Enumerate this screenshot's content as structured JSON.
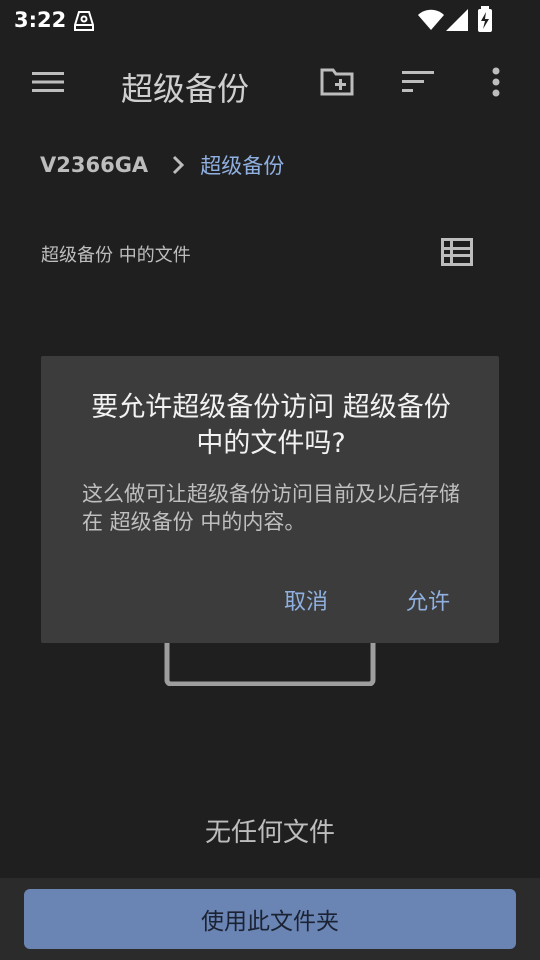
{
  "status_bar": {
    "time": "3:22"
  },
  "app_bar": {
    "title": "超级备份"
  },
  "breadcrumb": {
    "root": "V2366GA",
    "current": "超级备份"
  },
  "section": {
    "label": "超级备份 中的文件"
  },
  "empty_state": {
    "text": "无任何文件"
  },
  "bottom": {
    "use_folder_label": "使用此文件夹"
  },
  "dialog": {
    "title": "要允许超级备份访问 超级备份 中的文件吗?",
    "message": "这么做可让超级备份访问目前及以后存储在 超级备份 中的内容。",
    "cancel_label": "取消",
    "allow_label": "允许"
  },
  "colors": {
    "background": "#1f1f1f",
    "accent": "#8fb0e0",
    "button": "#6a85b4",
    "dialog": "#3c3c3c"
  },
  "icons": [
    "hard-drive-icon",
    "wifi-icon",
    "signal-icon",
    "battery-icon",
    "menu-icon",
    "new-folder-icon",
    "sort-icon",
    "more-vert-icon",
    "chevron-right-icon",
    "list-view-icon",
    "empty-folder-icon"
  ]
}
